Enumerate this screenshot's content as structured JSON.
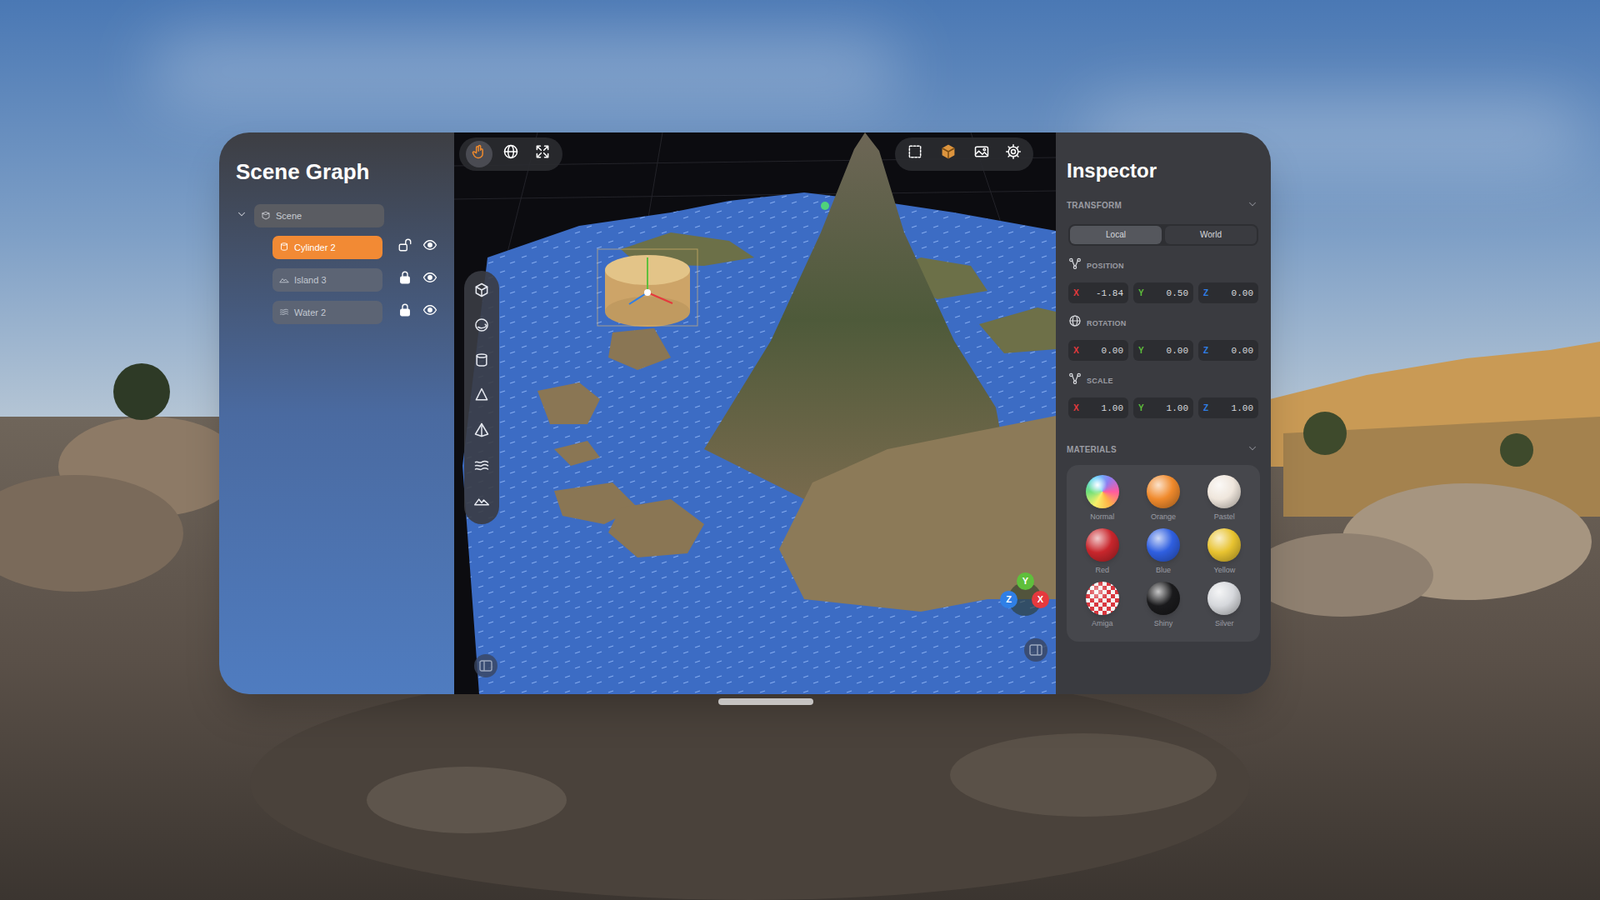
{
  "scene_graph": {
    "title": "Scene Graph",
    "root": {
      "label": "Scene",
      "expanded": true
    },
    "items": [
      {
        "label": "Cylinder 2",
        "kind": "cylinder",
        "selected": true,
        "locked": false,
        "visible": true
      },
      {
        "label": "Island 3",
        "kind": "terrain",
        "selected": false,
        "locked": true,
        "visible": true
      },
      {
        "label": "Water 2",
        "kind": "water",
        "selected": false,
        "locked": true,
        "visible": true
      }
    ]
  },
  "viewport": {
    "mode_tools": [
      {
        "kind": "hand",
        "selected": true
      },
      {
        "kind": "rotate",
        "selected": false
      },
      {
        "kind": "scale",
        "selected": false
      }
    ],
    "view_tools": [
      {
        "kind": "bounds",
        "selected": false
      },
      {
        "kind": "solid",
        "selected": true
      },
      {
        "kind": "image",
        "selected": false
      },
      {
        "kind": "settings",
        "selected": false
      }
    ],
    "add_tools": [
      {
        "kind": "cube"
      },
      {
        "kind": "sphere"
      },
      {
        "kind": "cylinder"
      },
      {
        "kind": "cone"
      },
      {
        "kind": "pyramid"
      },
      {
        "kind": "water"
      },
      {
        "kind": "terrain"
      }
    ],
    "gizmo": [
      {
        "axis": "Y",
        "color": "#5fbf3c"
      },
      {
        "axis": "Z",
        "color": "#2f7fe6"
      },
      {
        "axis": "X",
        "color": "#e5393d"
      }
    ]
  },
  "inspector": {
    "title": "Inspector",
    "transform": {
      "title": "TRANSFORM",
      "expanded": true,
      "segments": [
        {
          "label": "Local",
          "selected": true
        },
        {
          "label": "World",
          "selected": false
        }
      ],
      "rows": [
        {
          "label": "POSITION",
          "kind": "position",
          "values": [
            {
              "axis": "X",
              "value": "-1.84",
              "color": "#e5393d"
            },
            {
              "axis": "Y",
              "value": "0.50",
              "color": "#5fbf3c"
            },
            {
              "axis": "Z",
              "value": "0.00",
              "color": "#2f7fe6"
            }
          ]
        },
        {
          "label": "ROTATION",
          "kind": "rotation",
          "values": [
            {
              "axis": "X",
              "value": "0.00",
              "color": "#e5393d"
            },
            {
              "axis": "Y",
              "value": "0.00",
              "color": "#5fbf3c"
            },
            {
              "axis": "Z",
              "value": "0.00",
              "color": "#2f7fe6"
            }
          ]
        },
        {
          "label": "SCALE",
          "kind": "scale",
          "values": [
            {
              "axis": "X",
              "value": "1.00",
              "color": "#e5393d"
            },
            {
              "axis": "Y",
              "value": "1.00",
              "color": "#5fbf3c"
            },
            {
              "axis": "Z",
              "value": "1.00",
              "color": "#2f7fe6"
            }
          ]
        }
      ]
    },
    "materials": {
      "title": "MATERIALS",
      "expanded": true,
      "items": [
        {
          "name": "Normal",
          "kind": "rainbow",
          "color": "#8f7cf0"
        },
        {
          "name": "Orange",
          "kind": "plain",
          "color": "#f08a2c"
        },
        {
          "name": "Pastel",
          "kind": "plain",
          "color": "#efe6dc"
        },
        {
          "name": "Red",
          "kind": "plain",
          "color": "#c8262c"
        },
        {
          "name": "Blue",
          "kind": "plain",
          "color": "#2f5fe0"
        },
        {
          "name": "Yellow",
          "kind": "plain",
          "color": "#e8c330"
        },
        {
          "name": "Amiga",
          "kind": "checker",
          "color": "#d9363e"
        },
        {
          "name": "Shiny",
          "kind": "plain",
          "color": "#1a1a1c"
        },
        {
          "name": "Silver",
          "kind": "plain",
          "color": "#d6d8dc"
        }
      ]
    }
  }
}
